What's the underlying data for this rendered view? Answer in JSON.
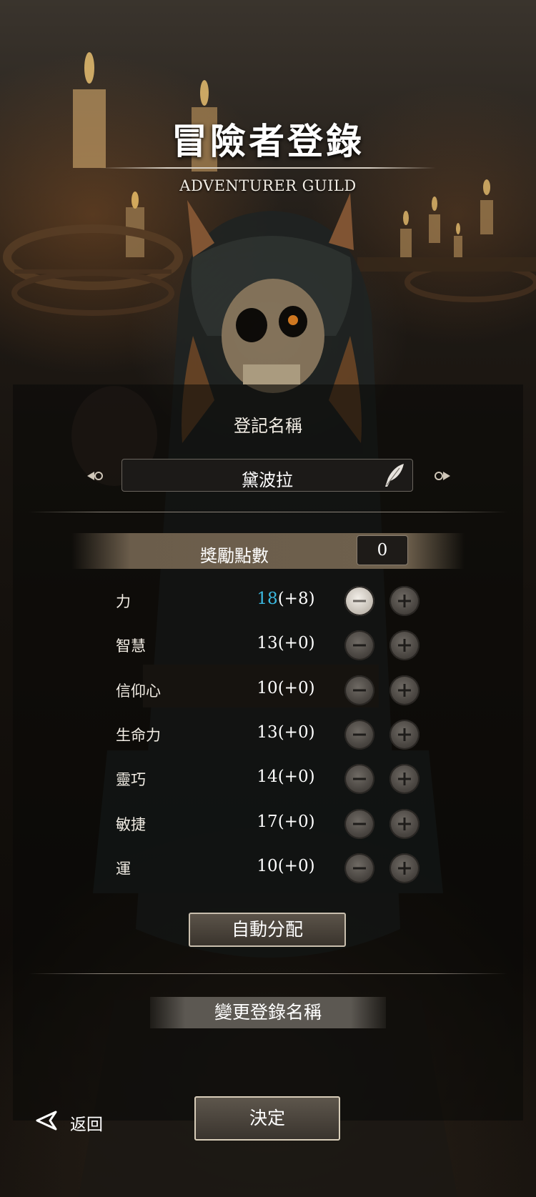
{
  "header": {
    "title": "冒險者登錄",
    "subtitle": "ADVENTURER GUILD"
  },
  "registration": {
    "name_label": "登記名稱",
    "name_value": "黛波拉"
  },
  "bonus": {
    "label": "獎勵點數",
    "value": "0"
  },
  "stats": [
    {
      "name": "力",
      "base": "18",
      "bonus": "(+8)",
      "highlight": true
    },
    {
      "name": "智慧",
      "base": "13",
      "bonus": "(+0)",
      "highlight": false
    },
    {
      "name": "信仰心",
      "base": "10",
      "bonus": "(+0)",
      "highlight": false
    },
    {
      "name": "生命力",
      "base": "13",
      "bonus": "(+0)",
      "highlight": false
    },
    {
      "name": "靈巧",
      "base": "14",
      "bonus": "(+0)",
      "highlight": false
    },
    {
      "name": "敏捷",
      "base": "17",
      "bonus": "(+0)",
      "highlight": false
    },
    {
      "name": "運",
      "base": "10",
      "bonus": "(+0)",
      "highlight": false
    }
  ],
  "actions": {
    "auto_assign": "自動分配",
    "change_name": "變更登錄名稱",
    "back": "返回",
    "confirm": "決定"
  },
  "colors": {
    "highlight_value": "#3bb9e0",
    "accent_gold": "#c9bfae"
  },
  "icons": {
    "minus": "minus-icon",
    "plus": "plus-icon",
    "quill": "quill-icon",
    "back": "back-arrow-icon"
  }
}
